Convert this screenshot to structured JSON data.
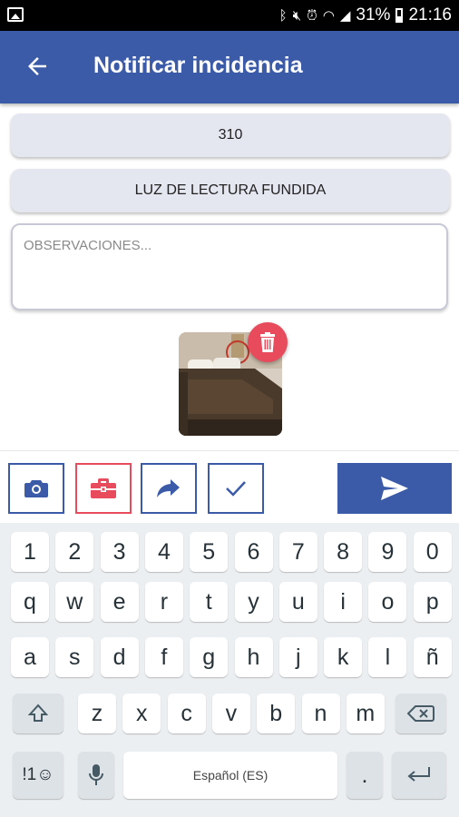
{
  "status_bar": {
    "icons": [
      "gallery-icon",
      "bluetooth-icon",
      "mute-icon",
      "alarm-icon",
      "wifi-icon",
      "signal-icon",
      "battery-icon"
    ],
    "battery_text": "31%",
    "time": "21:16"
  },
  "app_bar": {
    "title": "Notificar incidencia",
    "color": "#3b5ba8"
  },
  "form": {
    "room": "310",
    "incident": "LUZ DE LECTURA FUNDIDA",
    "observations_placeholder": "OBSERVACIONES...",
    "observations_value": ""
  },
  "photo": {
    "delete_color": "#e84b5c"
  },
  "toolbar": {
    "buttons": [
      "camera-icon",
      "toolbox-icon",
      "share-icon",
      "check-icon"
    ],
    "send_icon": "send-icon"
  },
  "keyboard": {
    "row_numbers": [
      "1",
      "2",
      "3",
      "4",
      "5",
      "6",
      "7",
      "8",
      "9",
      "0"
    ],
    "row1": [
      "q",
      "w",
      "e",
      "r",
      "t",
      "y",
      "u",
      "i",
      "o",
      "p"
    ],
    "row2": [
      "a",
      "s",
      "d",
      "f",
      "g",
      "h",
      "j",
      "k",
      "l",
      "ñ"
    ],
    "row3": [
      "z",
      "x",
      "c",
      "v",
      "b",
      "n",
      "m"
    ],
    "symbols_label": "!1☺",
    "space_label": "Español (ES)",
    "period_label": "."
  }
}
